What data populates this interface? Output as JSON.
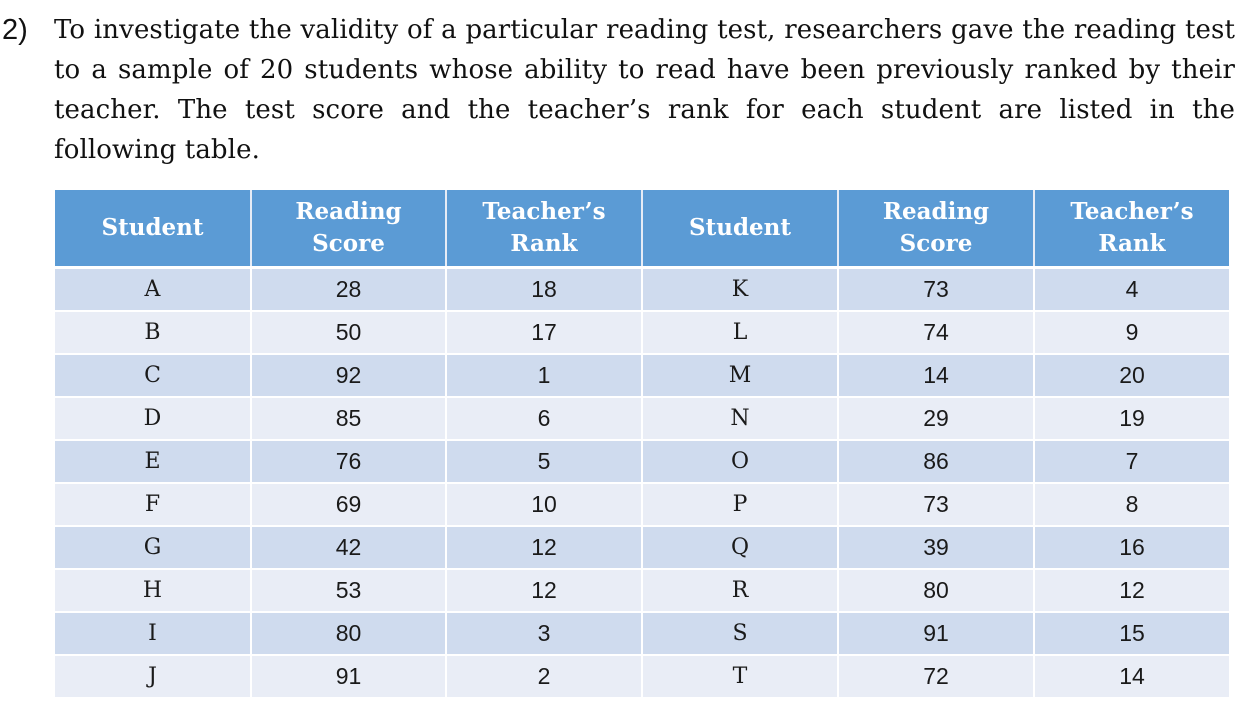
{
  "question": {
    "number": "2)",
    "text": "To investigate the validity of a particular reading test, researchers gave the reading test to a sample of 20 students whose ability to read have been previously ranked by their teacher. The test score and the teacher’s rank for each student are listed in the following table."
  },
  "table": {
    "headers": [
      {
        "line1": "Student",
        "line2": ""
      },
      {
        "line1": "Reading",
        "line2": "Score"
      },
      {
        "line1": "Teacher’s",
        "line2": "Rank"
      },
      {
        "line1": "Student",
        "line2": ""
      },
      {
        "line1": "Reading",
        "line2": "Score"
      },
      {
        "line1": "Teacher’s",
        "line2": "Rank"
      }
    ],
    "rows": [
      {
        "left": {
          "student": "A",
          "score": "28",
          "rank": "18"
        },
        "right": {
          "student": "K",
          "score": "73",
          "rank": "4"
        }
      },
      {
        "left": {
          "student": "B",
          "score": "50",
          "rank": "17"
        },
        "right": {
          "student": "L",
          "score": "74",
          "rank": "9"
        }
      },
      {
        "left": {
          "student": "C",
          "score": "92",
          "rank": "1"
        },
        "right": {
          "student": "M",
          "score": "14",
          "rank": "20"
        }
      },
      {
        "left": {
          "student": "D",
          "score": "85",
          "rank": "6"
        },
        "right": {
          "student": "N",
          "score": "29",
          "rank": "19"
        }
      },
      {
        "left": {
          "student": "E",
          "score": "76",
          "rank": "5"
        },
        "right": {
          "student": "O",
          "score": "86",
          "rank": "7"
        }
      },
      {
        "left": {
          "student": "F",
          "score": "69",
          "rank": "10"
        },
        "right": {
          "student": "P",
          "score": "73",
          "rank": "8"
        }
      },
      {
        "left": {
          "student": "G",
          "score": "42",
          "rank": "12"
        },
        "right": {
          "student": "Q",
          "score": "39",
          "rank": "16"
        }
      },
      {
        "left": {
          "student": "H",
          "score": "53",
          "rank": "12"
        },
        "right": {
          "student": "R",
          "score": "80",
          "rank": "12"
        }
      },
      {
        "left": {
          "student": "I",
          "score": "80",
          "rank": "3"
        },
        "right": {
          "student": "S",
          "score": "91",
          "rank": "15"
        }
      },
      {
        "left": {
          "student": "J",
          "score": "91",
          "rank": "2"
        },
        "right": {
          "student": "T",
          "score": "72",
          "rank": "14"
        }
      }
    ]
  },
  "colors": {
    "header_bg": "#5b9bd5",
    "header_text": "#ffffff",
    "row_odd_bg": "#cfdbee",
    "row_even_bg": "#e9edf6"
  }
}
